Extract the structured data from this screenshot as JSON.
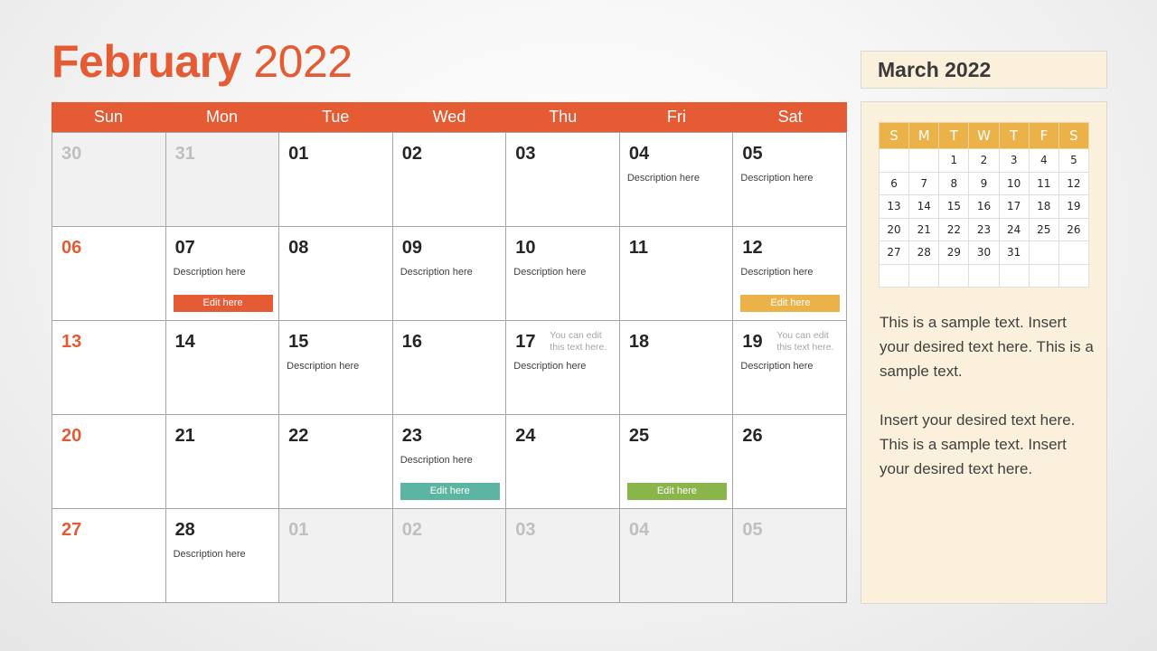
{
  "title": {
    "month": "February",
    "year": "2022"
  },
  "colors": {
    "accent": "#e55b34",
    "yellow": "#ecb24a",
    "teal": "#5bb5a2",
    "green": "#8ab54b",
    "panel_bg": "#fbf0dc"
  },
  "weekdays": [
    "Sun",
    "Mon",
    "Tue",
    "Wed",
    "Thu",
    "Fri",
    "Sat"
  ],
  "days": [
    {
      "num": "30",
      "other": true
    },
    {
      "num": "31",
      "other": true
    },
    {
      "num": "01"
    },
    {
      "num": "02"
    },
    {
      "num": "03"
    },
    {
      "num": "04",
      "desc": "Description here"
    },
    {
      "num": "05",
      "desc": "Description here"
    },
    {
      "num": "06",
      "sunday": true
    },
    {
      "num": "07",
      "desc": "Description here",
      "edit": "Edit here",
      "edit_color": "#e55b34"
    },
    {
      "num": "08"
    },
    {
      "num": "09",
      "desc": "Description here"
    },
    {
      "num": "10",
      "desc": "Description here"
    },
    {
      "num": "11"
    },
    {
      "num": "12",
      "desc": "Description here",
      "edit": "Edit here",
      "edit_color": "#ecb24a"
    },
    {
      "num": "13",
      "sunday": true
    },
    {
      "num": "14"
    },
    {
      "num": "15",
      "desc": "Description here"
    },
    {
      "num": "16"
    },
    {
      "num": "17",
      "desc": "Description here",
      "note": "You can edit this text here."
    },
    {
      "num": "18"
    },
    {
      "num": "19",
      "desc": "Description here",
      "note": "You can edit this text here."
    },
    {
      "num": "20",
      "sunday": true
    },
    {
      "num": "21"
    },
    {
      "num": "22"
    },
    {
      "num": "23",
      "desc": "Description here",
      "edit": "Edit here",
      "edit_color": "#5bb5a2"
    },
    {
      "num": "24"
    },
    {
      "num": "25",
      "edit": "Edit here",
      "edit_color": "#8ab54b"
    },
    {
      "num": "26"
    },
    {
      "num": "27",
      "sunday": true
    },
    {
      "num": "28",
      "desc": "Description here"
    },
    {
      "num": "01",
      "other": true
    },
    {
      "num": "02",
      "other": true
    },
    {
      "num": "03",
      "other": true
    },
    {
      "num": "04",
      "other": true
    },
    {
      "num": "05",
      "other": true
    }
  ],
  "sidebar": {
    "title": "March 2022",
    "mini_headers": [
      "S",
      "M",
      "T",
      "W",
      "T",
      "F",
      "S"
    ],
    "mini_weeks": [
      [
        "",
        "",
        "1",
        "2",
        "3",
        "4",
        "5"
      ],
      [
        "6",
        "7",
        "8",
        "9",
        "10",
        "11",
        "12"
      ],
      [
        "13",
        "14",
        "15",
        "16",
        "17",
        "18",
        "19"
      ],
      [
        "20",
        "21",
        "22",
        "23",
        "24",
        "25",
        "26"
      ],
      [
        "27",
        "28",
        "29",
        "30",
        "31",
        "",
        ""
      ],
      [
        "",
        "",
        "",
        "",
        "",
        "",
        ""
      ]
    ],
    "paragraphs": [
      "This is a sample text. Insert your desired text here. This is a sample text.",
      "Insert your desired text here. This is a sample text. Insert your desired text here."
    ]
  }
}
